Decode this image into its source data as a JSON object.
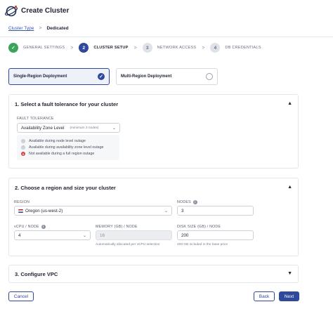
{
  "header": {
    "title": "Create Cluster",
    "logo_icon": "planet-logo-icon"
  },
  "breadcrumb": {
    "link": "Cluster Type",
    "separator": ">",
    "current": "Dedicated"
  },
  "steps": [
    {
      "number": "✓",
      "label": "GENERAL SETTINGS",
      "state": "done"
    },
    {
      "number": "2",
      "label": "CLUSTER SETUP",
      "state": "active"
    },
    {
      "number": "3",
      "label": "NETWORK ACCESS",
      "state": "pending"
    },
    {
      "number": "4",
      "label": "DB CREDENTIALS",
      "state": "pending"
    }
  ],
  "step_separator": ">",
  "deployment": {
    "single": {
      "label": "Single-Region Deployment",
      "selected": true
    },
    "multi": {
      "label": "Multi-Region Deployment",
      "selected": false
    }
  },
  "fault_section": {
    "title": "1. Select a fault tolerance for your cluster",
    "field_label": "FAULT TOLERANCE",
    "value": "Availability Zone Level",
    "value_hint": "(minimum 3 nodes)",
    "statuses": [
      {
        "text": "Available during node level outage",
        "state": "ok"
      },
      {
        "text": "Available during availability zone level outage",
        "state": "ok"
      },
      {
        "text": "Not available during a full region outage",
        "state": "bad"
      }
    ]
  },
  "region_section": {
    "title": "2. Choose a region and size your cluster",
    "region_label": "REGION",
    "region_value": "Oregon (us-west-2)",
    "nodes_label": "NODES",
    "nodes_value": "3",
    "vcpu_label": "vCPU / NODE",
    "vcpu_value": "4",
    "memory_label": "MEMORY (GB) / NODE",
    "memory_value": "16",
    "memory_hint": "Automatically allocated per vCPU selection",
    "disk_label": "DISK SIZE (GB) / NODE",
    "disk_value": "200",
    "disk_hint": "200 GB included in the base price"
  },
  "vpc_section": {
    "title": "3. Configure VPC"
  },
  "footer": {
    "cancel": "Cancel",
    "back": "Back",
    "next": "Next"
  },
  "colors": {
    "accent": "#2f4a9c",
    "success": "#3aa55a",
    "danger": "#d9464a"
  }
}
